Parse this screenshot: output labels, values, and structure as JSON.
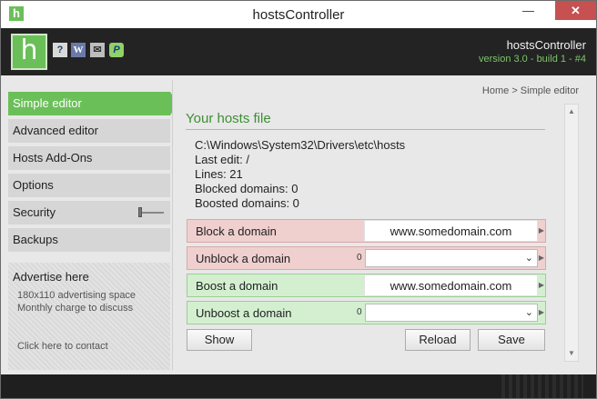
{
  "window": {
    "title": "hostsController",
    "app_icon": "h"
  },
  "header": {
    "logo_letter": "h",
    "icons": [
      "help-icon",
      "wiki-icon",
      "mail-icon",
      "paypal-icon"
    ],
    "icon_glyphs": {
      "help": "?",
      "wiki": "W",
      "mail": "✉",
      "paypal": "P"
    },
    "app_name": "hostsController",
    "version": "version 3.0 - build 1 - #4"
  },
  "sidebar": {
    "items": [
      {
        "label": "Simple editor",
        "active": true
      },
      {
        "label": "Advanced editor",
        "active": false
      },
      {
        "label": "Hosts Add-Ons",
        "active": false
      },
      {
        "label": "Options",
        "active": false
      },
      {
        "label": "Security",
        "active": false
      },
      {
        "label": "Backups",
        "active": false
      }
    ],
    "ad": {
      "title": "Advertise here",
      "line1": "180x110 advertising space",
      "line2": "Monthly charge to discuss",
      "contact": "Click here to contact"
    }
  },
  "main": {
    "breadcrumb": "Home > Simple editor",
    "title": "Your hosts file",
    "path": "C:\\Windows\\System32\\Drivers\\etc\\hosts",
    "last_edit": "Last edit: /",
    "lines": "Lines: 21",
    "blocked": "Blocked domains: 0",
    "boosted": "Boosted domains: 0",
    "block": {
      "label": "Block a domain",
      "value": "www.somedomain.com"
    },
    "unblock": {
      "label": "Unblock a domain",
      "count": "0",
      "selected": ""
    },
    "boost": {
      "label": "Boost a domain",
      "value": "www.somedomain.com"
    },
    "unboost": {
      "label": "Unboost a domain",
      "count": "0",
      "selected": ""
    },
    "buttons": {
      "show": "Show",
      "reload": "Reload",
      "save": "Save"
    }
  },
  "colors": {
    "accent": "#6bbf59",
    "title_green": "#3e8e35",
    "block_red": "#f0cfcf",
    "boost_green": "#d3efd0",
    "header_dark": "#232323"
  }
}
